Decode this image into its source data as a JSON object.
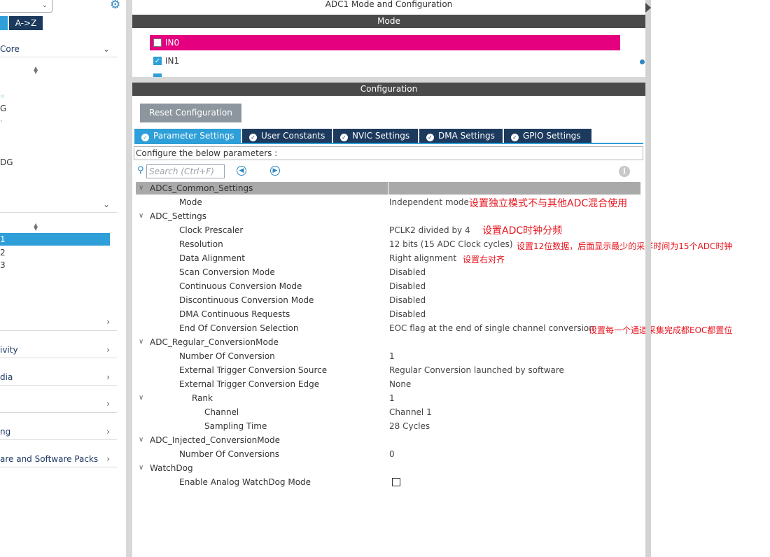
{
  "left_panel": {
    "sort_tabs": [
      "A->Z"
    ],
    "categories": [
      {
        "label": "Core",
        "chevron": "chevron-down-icon"
      },
      {
        "label": "",
        "chevron": "chevron-down-icon"
      },
      {
        "label": "",
        "chevron": "chevron-right-icon"
      },
      {
        "label": "ivity",
        "chevron": "chevron-right-icon"
      },
      {
        "label": "dia",
        "chevron": "chevron-right-icon"
      },
      {
        "label": "",
        "chevron": "chevron-right-icon"
      },
      {
        "label": "ng",
        "chevron": "chevron-right-icon"
      },
      {
        "label": "are and Software Packs",
        "chevron": "chevron-right-icon"
      }
    ],
    "core_items": [
      "G",
      "DG"
    ],
    "analog_items": [
      "1",
      "2",
      "3"
    ],
    "selected_item": "1"
  },
  "mode_panel": {
    "title": "ADC1 Mode and Configuration",
    "mode_header": "Mode",
    "inputs": [
      {
        "label": "IN0",
        "checked": false,
        "highlighted": true
      },
      {
        "label": "IN1",
        "checked": true,
        "highlighted": false
      }
    ]
  },
  "config_panel": {
    "header": "Configuration",
    "reset_button": "Reset Configuration",
    "tabs": [
      {
        "label": "Parameter Settings",
        "active": true
      },
      {
        "label": "User Constants",
        "active": false
      },
      {
        "label": "NVIC Settings",
        "active": false
      },
      {
        "label": "DMA Settings",
        "active": false
      },
      {
        "label": "GPIO Settings",
        "active": false
      }
    ],
    "description": "Configure the below parameters :",
    "search_placeholder": "Search (Ctrl+F)"
  },
  "params": [
    {
      "name": "ADCs_Common_Settings",
      "value": "",
      "level": 0,
      "group": true,
      "expanded": true
    },
    {
      "name": "Mode",
      "value": "Independent mode",
      "level": 1
    },
    {
      "name": "ADC_Settings",
      "value": "",
      "level": 0,
      "group": true,
      "expanded": true
    },
    {
      "name": "Clock Prescaler",
      "value": "PCLK2 divided by 4",
      "level": 1
    },
    {
      "name": "Resolution",
      "value": "12 bits (15 ADC Clock cycles)",
      "level": 1
    },
    {
      "name": "Data Alignment",
      "value": "Right alignment",
      "level": 1
    },
    {
      "name": "Scan Conversion Mode",
      "value": "Disabled",
      "level": 1
    },
    {
      "name": "Continuous Conversion Mode",
      "value": "Disabled",
      "level": 1
    },
    {
      "name": "Discontinuous Conversion Mode",
      "value": "Disabled",
      "level": 1
    },
    {
      "name": "DMA Continuous Requests",
      "value": "Disabled",
      "level": 1
    },
    {
      "name": "End Of Conversion Selection",
      "value": "EOC flag at the end of single channel conversion",
      "level": 1
    },
    {
      "name": "ADC_Regular_ConversionMode",
      "value": "",
      "level": 0,
      "group": true,
      "expanded": true
    },
    {
      "name": "Number Of Conversion",
      "value": "1",
      "level": 1
    },
    {
      "name": "External Trigger Conversion Source",
      "value": "Regular Conversion launched by software",
      "level": 1
    },
    {
      "name": "External Trigger Conversion Edge",
      "value": "None",
      "level": 1
    },
    {
      "name": "Rank",
      "value": "1",
      "level": 2,
      "group": true,
      "expanded": true
    },
    {
      "name": "Channel",
      "value": "Channel 1",
      "level": 3
    },
    {
      "name": "Sampling Time",
      "value": "28 Cycles",
      "level": 3
    },
    {
      "name": "ADC_Injected_ConversionMode",
      "value": "",
      "level": 0,
      "group": true,
      "expanded": true
    },
    {
      "name": "Number Of Conversions",
      "value": "0",
      "level": 1
    },
    {
      "name": "WatchDog",
      "value": "",
      "level": 0,
      "group": true,
      "expanded": true
    },
    {
      "name": "Enable Analog WatchDog Mode",
      "value": "",
      "level": 1,
      "checkbox": true,
      "checked": false
    }
  ],
  "annotations": {
    "mode": "设置独立模式不与其他ADC混合使用",
    "clock": "设置ADC时钟分频",
    "resolution": "设置12位数据，后面显示最少的采样时间为15个ADC时钟",
    "alignment": "设置右对齐",
    "eoc": "设置每一个通道采集完成都EOC都置位"
  },
  "colors": {
    "accent": "#2e9fd8",
    "tab_dark": "#1c3a5e",
    "highlight": "#e4007f",
    "annotation": "#e8141e"
  }
}
